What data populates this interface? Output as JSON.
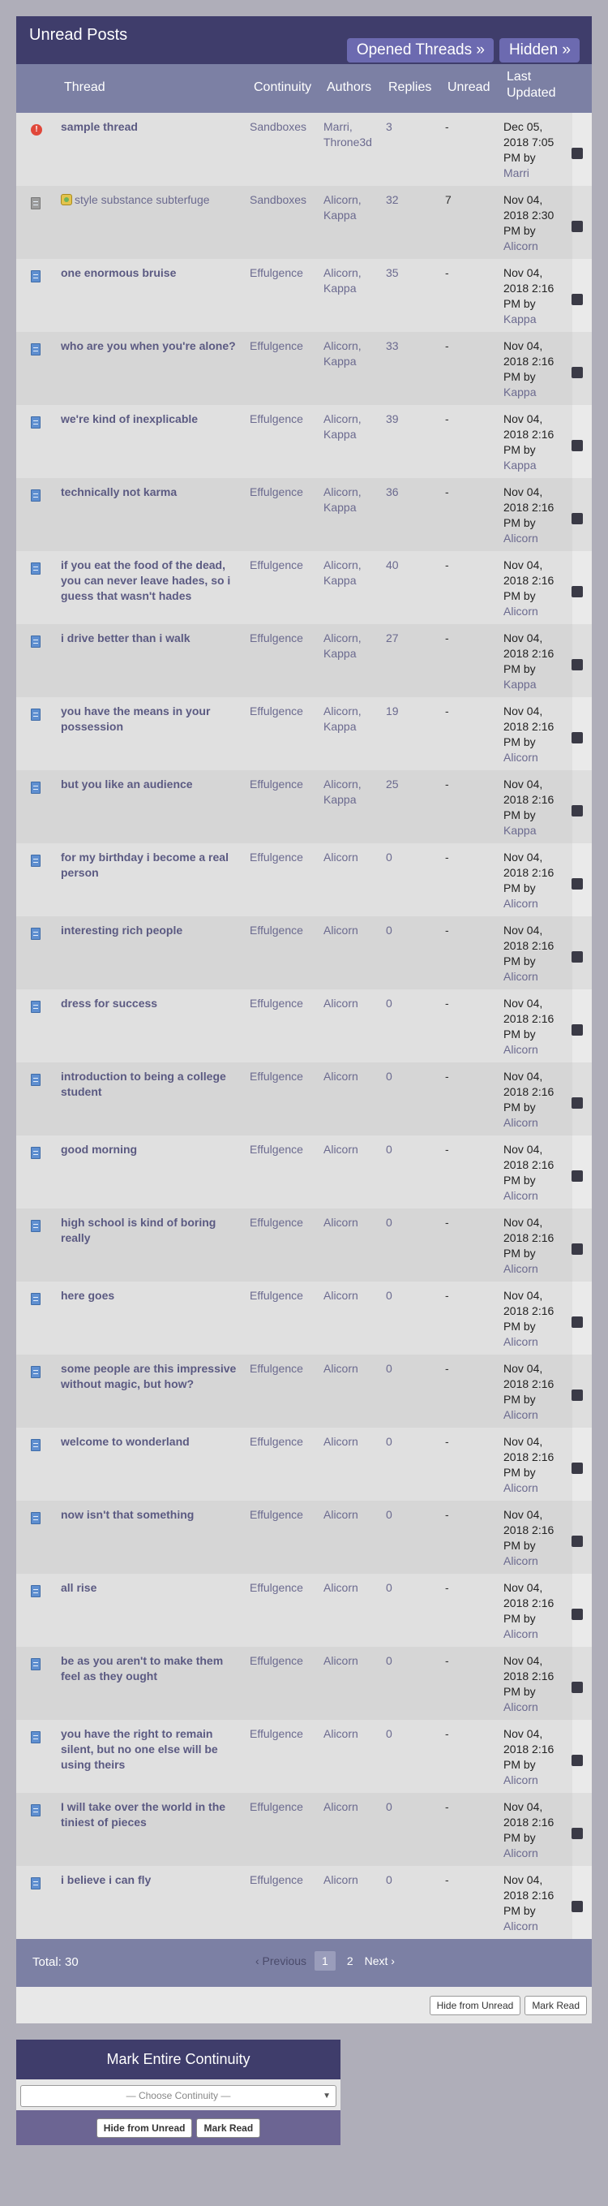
{
  "header": {
    "title": "Unread Posts",
    "opened_threads": "Opened Threads »",
    "hidden": "Hidden »"
  },
  "columns": {
    "thread": "Thread",
    "continuity": "Continuity",
    "authors": "Authors",
    "replies": "Replies",
    "unread": "Unread",
    "last_updated_1": "Last",
    "last_updated_2": "Updated"
  },
  "rows": [
    {
      "title": "sample thread",
      "cont": "Sandboxes",
      "authors": "Marri, Throne3d",
      "replies": "3",
      "unread": "-",
      "date": "Dec 05, 2018 7:05 PM by",
      "user": "Marri",
      "icon": "alert-icon",
      "bold": true
    },
    {
      "title": "style substance subterfuge",
      "cont": "Sandboxes",
      "authors": "Alicorn, Kappa",
      "replies": "32",
      "unread": "7",
      "date": "Nov 04, 2018 2:30 PM by",
      "user": "Alicorn",
      "icon": "grey-doc-icon",
      "bold": false
    },
    {
      "title": "one enormous bruise",
      "cont": "Effulgence",
      "authors": "Alicorn, Kappa",
      "replies": "35",
      "unread": "-",
      "date": "Nov 04, 2018 2:16 PM by",
      "user": "Kappa",
      "icon": "doc-icon",
      "bold": true
    },
    {
      "title": "who are you when you're alone?",
      "cont": "Effulgence",
      "authors": "Alicorn, Kappa",
      "replies": "33",
      "unread": "-",
      "date": "Nov 04, 2018 2:16 PM by",
      "user": "Kappa",
      "icon": "doc-icon",
      "bold": true
    },
    {
      "title": "we're kind of inexplicable",
      "cont": "Effulgence",
      "authors": "Alicorn, Kappa",
      "replies": "39",
      "unread": "-",
      "date": "Nov 04, 2018 2:16 PM by",
      "user": "Kappa",
      "icon": "doc-icon",
      "bold": true
    },
    {
      "title": "technically not karma",
      "cont": "Effulgence",
      "authors": "Alicorn, Kappa",
      "replies": "36",
      "unread": "-",
      "date": "Nov 04, 2018 2:16 PM by",
      "user": "Alicorn",
      "icon": "doc-icon",
      "bold": true
    },
    {
      "title": "if you eat the food of the dead, you can never leave hades, so i guess that wasn't hades",
      "cont": "Effulgence",
      "authors": "Alicorn, Kappa",
      "replies": "40",
      "unread": "-",
      "date": "Nov 04, 2018 2:16 PM by",
      "user": "Alicorn",
      "icon": "doc-icon",
      "bold": true
    },
    {
      "title": "i drive better than i walk",
      "cont": "Effulgence",
      "authors": "Alicorn, Kappa",
      "replies": "27",
      "unread": "-",
      "date": "Nov 04, 2018 2:16 PM by",
      "user": "Kappa",
      "icon": "doc-icon",
      "bold": true
    },
    {
      "title": "you have the means in your possession",
      "cont": "Effulgence",
      "authors": "Alicorn, Kappa",
      "replies": "19",
      "unread": "-",
      "date": "Nov 04, 2018 2:16 PM by",
      "user": "Alicorn",
      "icon": "doc-icon",
      "bold": true
    },
    {
      "title": "but you like an audience",
      "cont": "Effulgence",
      "authors": "Alicorn, Kappa",
      "replies": "25",
      "unread": "-",
      "date": "Nov 04, 2018 2:16 PM by",
      "user": "Kappa",
      "icon": "doc-icon",
      "bold": true
    },
    {
      "title": "for my birthday i become a real person",
      "cont": "Effulgence",
      "authors": "Alicorn",
      "replies": "0",
      "unread": "-",
      "date": "Nov 04, 2018 2:16 PM by",
      "user": "Alicorn",
      "icon": "doc-icon",
      "bold": true
    },
    {
      "title": "interesting rich people",
      "cont": "Effulgence",
      "authors": "Alicorn",
      "replies": "0",
      "unread": "-",
      "date": "Nov 04, 2018 2:16 PM by",
      "user": "Alicorn",
      "icon": "doc-icon",
      "bold": true
    },
    {
      "title": "dress for success",
      "cont": "Effulgence",
      "authors": "Alicorn",
      "replies": "0",
      "unread": "-",
      "date": "Nov 04, 2018 2:16 PM by",
      "user": "Alicorn",
      "icon": "doc-icon",
      "bold": true
    },
    {
      "title": "introduction to being a college student",
      "cont": "Effulgence",
      "authors": "Alicorn",
      "replies": "0",
      "unread": "-",
      "date": "Nov 04, 2018 2:16 PM by",
      "user": "Alicorn",
      "icon": "doc-icon",
      "bold": true
    },
    {
      "title": "good morning",
      "cont": "Effulgence",
      "authors": "Alicorn",
      "replies": "0",
      "unread": "-",
      "date": "Nov 04, 2018 2:16 PM by",
      "user": "Alicorn",
      "icon": "doc-icon",
      "bold": true
    },
    {
      "title": "high school is kind of boring really",
      "cont": "Effulgence",
      "authors": "Alicorn",
      "replies": "0",
      "unread": "-",
      "date": "Nov 04, 2018 2:16 PM by",
      "user": "Alicorn",
      "icon": "doc-icon",
      "bold": true
    },
    {
      "title": "here goes",
      "cont": "Effulgence",
      "authors": "Alicorn",
      "replies": "0",
      "unread": "-",
      "date": "Nov 04, 2018 2:16 PM by",
      "user": "Alicorn",
      "icon": "doc-icon",
      "bold": true
    },
    {
      "title": "some people are this impressive without magic, but how?",
      "cont": "Effulgence",
      "authors": "Alicorn",
      "replies": "0",
      "unread": "-",
      "date": "Nov 04, 2018 2:16 PM by",
      "user": "Alicorn",
      "icon": "doc-icon",
      "bold": true
    },
    {
      "title": "welcome to wonderland",
      "cont": "Effulgence",
      "authors": "Alicorn",
      "replies": "0",
      "unread": "-",
      "date": "Nov 04, 2018 2:16 PM by",
      "user": "Alicorn",
      "icon": "doc-icon",
      "bold": true
    },
    {
      "title": "now isn't that something",
      "cont": "Effulgence",
      "authors": "Alicorn",
      "replies": "0",
      "unread": "-",
      "date": "Nov 04, 2018 2:16 PM by",
      "user": "Alicorn",
      "icon": "doc-icon",
      "bold": true
    },
    {
      "title": "all rise",
      "cont": "Effulgence",
      "authors": "Alicorn",
      "replies": "0",
      "unread": "-",
      "date": "Nov 04, 2018 2:16 PM by",
      "user": "Alicorn",
      "icon": "doc-icon",
      "bold": true
    },
    {
      "title": "be as you aren't to make them feel as they ought",
      "cont": "Effulgence",
      "authors": "Alicorn",
      "replies": "0",
      "unread": "-",
      "date": "Nov 04, 2018 2:16 PM by",
      "user": "Alicorn",
      "icon": "doc-icon",
      "bold": true
    },
    {
      "title": "you have the right to remain silent, but no one else will be using theirs",
      "cont": "Effulgence",
      "authors": "Alicorn",
      "replies": "0",
      "unread": "-",
      "date": "Nov 04, 2018 2:16 PM by",
      "user": "Alicorn",
      "icon": "doc-icon",
      "bold": true
    },
    {
      "title": "I will take over the world in the tiniest of pieces",
      "cont": "Effulgence",
      "authors": "Alicorn",
      "replies": "0",
      "unread": "-",
      "date": "Nov 04, 2018 2:16 PM by",
      "user": "Alicorn",
      "icon": "doc-icon",
      "bold": true
    },
    {
      "title": "i believe i can fly",
      "cont": "Effulgence",
      "authors": "Alicorn",
      "replies": "0",
      "unread": "-",
      "date": "Nov 04, 2018 2:16 PM by",
      "user": "Alicorn",
      "icon": "doc-icon",
      "bold": true
    }
  ],
  "footer": {
    "total": "Total: 30",
    "prev": "‹ Previous",
    "page1": "1",
    "page2": "2",
    "next": "Next ›"
  },
  "actions": {
    "hide_from_unread": "Hide from Unread",
    "mark_read": "Mark Read"
  },
  "mark_continuity": {
    "title": "Mark Entire Continuity",
    "select_placeholder": "— Choose Continuity —",
    "hide_from_unread": "Hide from Unread",
    "mark_read": "Mark Read"
  }
}
